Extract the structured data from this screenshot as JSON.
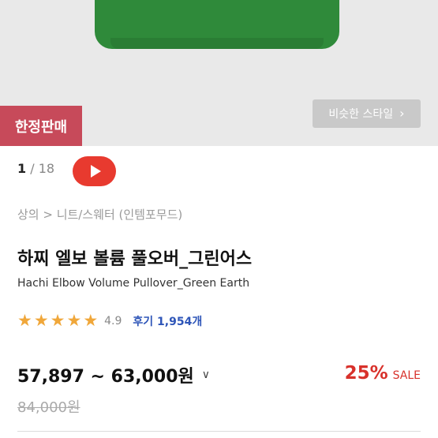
{
  "hero": {
    "badge": "한정판매",
    "similar_style_label": "비슷한 스타일"
  },
  "media": {
    "current": "1",
    "separator": "/",
    "total": "18"
  },
  "breadcrumb": "상의 > 니트/스웨터 (인템포무드)",
  "product": {
    "title_ko": "하찌 엘보 볼륨 풀오버_그린어스",
    "title_en": "Hachi Elbow Volume Pullover_Green Earth"
  },
  "rating": {
    "score": "4.9",
    "stars": 5,
    "reviews": "후기 1,954개"
  },
  "price": {
    "range": "57,897 ~ 63,000원",
    "discount_percent": "25%",
    "discount_label": "SALE",
    "original": "84,000원"
  },
  "colors": {
    "accent_red": "#e83a2f",
    "sale_red": "#d8312b",
    "badge_bg": "#c74a5a",
    "review_blue": "#2e55b8",
    "star": "#f0a73a",
    "product_green": "#2f8a3a"
  }
}
